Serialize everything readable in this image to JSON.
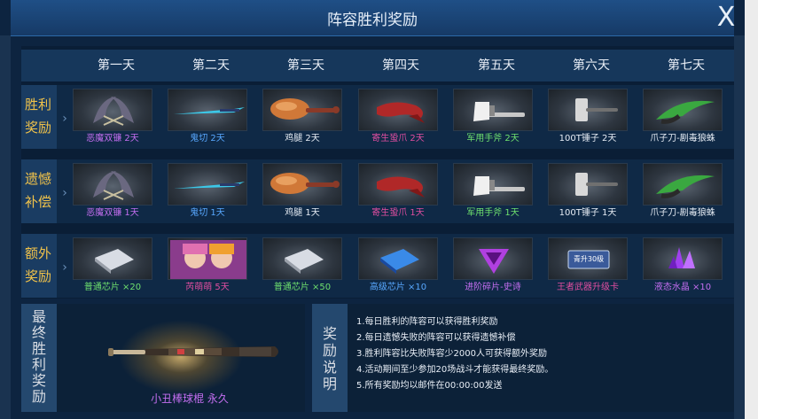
{
  "dialog": {
    "title": "阵容胜利奖励",
    "close_label": "X"
  },
  "days": [
    "第一天",
    "第二天",
    "第三天",
    "第四天",
    "第五天",
    "第六天",
    "第七天"
  ],
  "rows": [
    {
      "label_line1": "胜利",
      "label_line2": "奖励",
      "items": [
        {
          "name": "恶魔双镰 2天",
          "color": "purple",
          "icon": "dual-scythe-icon"
        },
        {
          "name": "鬼切 2天",
          "color": "blue",
          "icon": "katana-icon"
        },
        {
          "name": "鸡腿 2天",
          "color": "white",
          "icon": "chicken-leg-icon"
        },
        {
          "name": "寄生蛩爪 2天",
          "color": "pink",
          "icon": "parasite-claw-icon"
        },
        {
          "name": "军用手斧 2天",
          "color": "green",
          "icon": "hand-axe-icon"
        },
        {
          "name": "100T锤子 2天",
          "color": "white",
          "icon": "hammer-icon"
        },
        {
          "name": "爪子刀-剧毒狼蛛",
          "color": "white",
          "icon": "karambit-icon"
        }
      ]
    },
    {
      "label_line1": "遗憾",
      "label_line2": "补偿",
      "items": [
        {
          "name": "恶魔双镰 1天",
          "color": "purple",
          "icon": "dual-scythe-icon"
        },
        {
          "name": "鬼切 1天",
          "color": "blue",
          "icon": "katana-icon"
        },
        {
          "name": "鸡腿 1天",
          "color": "white",
          "icon": "chicken-leg-icon"
        },
        {
          "name": "寄生蛩爪 1天",
          "color": "pink",
          "icon": "parasite-claw-icon"
        },
        {
          "name": "军用手斧 1天",
          "color": "green",
          "icon": "hand-axe-icon"
        },
        {
          "name": "100T锤子 1天",
          "color": "white",
          "icon": "hammer-icon"
        },
        {
          "name": "爪子刀-剧毒狼蛛",
          "color": "white",
          "icon": "karambit-icon"
        }
      ]
    },
    {
      "label_line1": "额外",
      "label_line2": "奖励",
      "items": [
        {
          "name": "普通芯片 ×20",
          "color": "green",
          "icon": "chip-icon"
        },
        {
          "name": "芮萌萌 5天",
          "color": "pink",
          "icon": "character-portrait-icon"
        },
        {
          "name": "普通芯片 ×50",
          "color": "green",
          "icon": "chip-icon"
        },
        {
          "name": "高级芯片 ×10",
          "color": "blue",
          "icon": "advanced-chip-icon"
        },
        {
          "name": "进阶碎片-史诗",
          "color": "purple",
          "icon": "gem-shard-icon"
        },
        {
          "name": "王者武器升级卡",
          "color": "pink",
          "icon": "upgrade-card-icon",
          "card_text": "青升30级"
        },
        {
          "name": "液态水晶 ×10",
          "color": "purple",
          "icon": "crystal-icon"
        }
      ]
    }
  ],
  "final": {
    "label_chars": [
      "最",
      "终",
      "胜",
      "利",
      "奖",
      "励"
    ],
    "item_name": "小丑棒球棍 永久",
    "icon": "baseball-bat-icon"
  },
  "explanation": {
    "label_chars": [
      "奖",
      "励",
      "说",
      "明"
    ],
    "rules": [
      "1.每日胜利的阵容可以获得胜利奖励",
      "2.每日遗憾失败的阵容可以获得遗憾补偿",
      "3.胜利阵容比失败阵容少2000人可获得额外奖励",
      "4.活动期间至少参加20场战斗才能获得最终奖励。",
      "5.所有奖励均以邮件在00:00:00发送"
    ]
  },
  "colors": {
    "purple": "#c46ef0",
    "blue": "#58a8ff",
    "white": "#e6ecf4",
    "pink": "#e04ea0",
    "green": "#6ee06e",
    "gold": "#f0c24a"
  }
}
